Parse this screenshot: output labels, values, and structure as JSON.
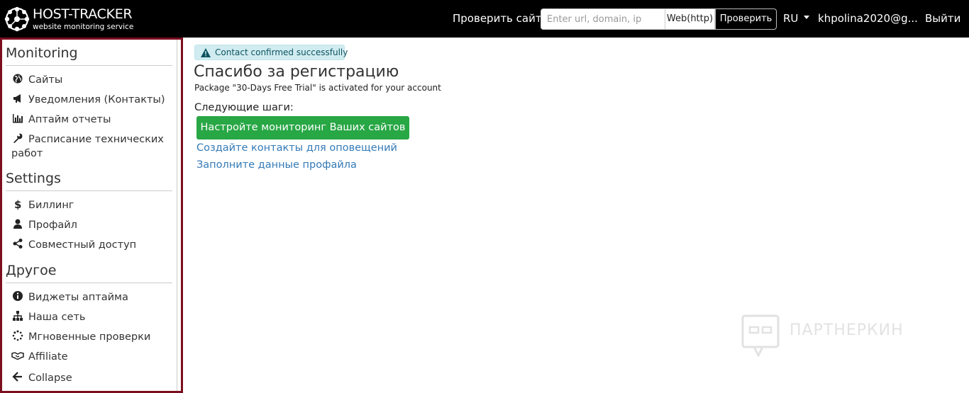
{
  "header": {
    "brand_title": "HOST-TRACKER",
    "brand_subtitle": "website monitoring service",
    "check_label": "Проверить сайт",
    "url_placeholder": "Enter url, domain, ip",
    "check_type": "Web(http)",
    "check_button": "Проверить",
    "language": "RU",
    "user": "khpolina2020@g...",
    "logout": "Выйти"
  },
  "sidebar": {
    "sections": [
      {
        "title": "Monitoring",
        "items": [
          {
            "label": "Сайты",
            "icon": "globe-icon"
          },
          {
            "label": "Уведомления (Контакты)",
            "icon": "bullhorn-icon"
          },
          {
            "label": "Аптайм отчеты",
            "icon": "bar-chart-icon"
          },
          {
            "label": "Расписание технических работ",
            "icon": "wrench-icon"
          }
        ]
      },
      {
        "title": "Settings",
        "items": [
          {
            "label": "Биллинг",
            "icon": "dollar-icon"
          },
          {
            "label": "Профайл",
            "icon": "user-icon"
          },
          {
            "label": "Совместный доступ",
            "icon": "share-icon"
          }
        ]
      },
      {
        "title": "Другое",
        "items": [
          {
            "label": "Виджеты аптайма",
            "icon": "info-icon"
          },
          {
            "label": "Наша сеть",
            "icon": "sitemap-icon"
          },
          {
            "label": "Мгновенные проверки",
            "icon": "spinner-icon"
          },
          {
            "label": "Affiliate",
            "icon": "handshake-icon"
          },
          {
            "label": "Collapse",
            "icon": "arrow-left-icon"
          }
        ]
      }
    ]
  },
  "main": {
    "alert": "Contact confirmed successfully",
    "title": "Спасибо за регистрацию",
    "package_text": "Package \"30-Days Free Trial\" is activated for your account",
    "next_steps_label": "Следующие шаги:",
    "setup_button": "Настройте мониторинг Ваших сайтов",
    "links": [
      "Создайте контакты для оповещений",
      "Заполните данные профайла"
    ]
  },
  "watermark": {
    "text": "ПАРТНЕРКИН"
  },
  "colors": {
    "navbar": "#000000",
    "sidebar_border": "#7a0e1e",
    "primary_button": "#28a745",
    "link": "#337ab7",
    "alert_bg": "#d1ecf1"
  }
}
